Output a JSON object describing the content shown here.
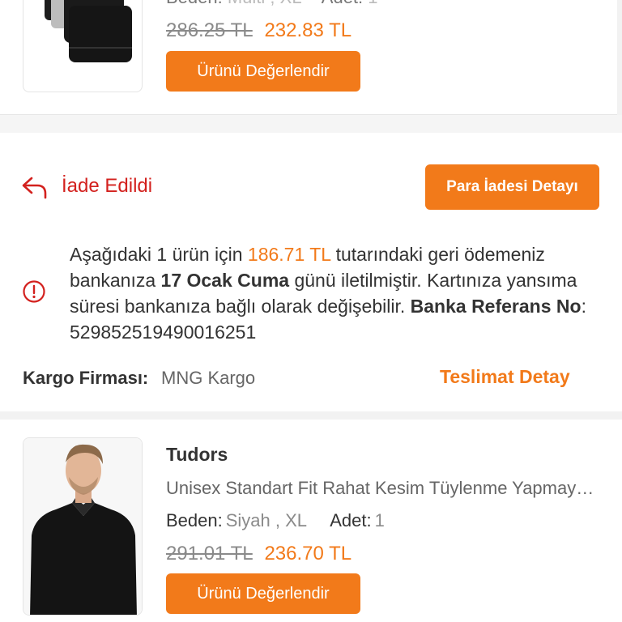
{
  "top_product": {
    "cut_line": {
      "size_label": "Beden:",
      "size_value": "Multi , XL",
      "qty_label": "Adet:",
      "qty_value": "1"
    },
    "old_price": "286.25 TL",
    "new_price": "232.83 TL",
    "review_label": "Ürünü Değerlendir",
    "image_icon": "boxer-pack-image"
  },
  "return_status": {
    "icon": "return-arrow-icon",
    "label": "İade Edildi",
    "refund_button": "Para İadesi Detayı"
  },
  "refund_info": {
    "icon": "info-circle-icon",
    "part1": "Aşağıdaki 1 ürün için ",
    "amount": "186.71 TL",
    "part2": " tutarındaki geri ödemeniz bankanıza ",
    "date": "17 Ocak Cuma",
    "part3": " günü iletilmiştir. Kartınıza yansıma süresi bankanıza bağlı olarak değişebilir. ",
    "ref_label": "Banka Referans No",
    "ref_sep": ": ",
    "ref_value": "529852519490016251"
  },
  "cargo": {
    "label": "Kargo Firması:",
    "value": "MNG Kargo",
    "delivery_link": "Teslimat Detay"
  },
  "bottom_product": {
    "brand": "Tudors",
    "name": "Unisex Standart Fit Rahat Kesim Tüylenme Yapmayan Polar Sweatshirt",
    "size_label": "Beden:",
    "size_value": "Siyah , XL",
    "qty_label": "Adet:",
    "qty_value": "1",
    "old_price": "291.01 TL",
    "new_price": "236.70 TL",
    "review_label": "Ürünü Değerlendir",
    "image_icon": "sweatshirt-model-image"
  },
  "colors": {
    "accent": "#f27a1a",
    "status_red": "#d3211e"
  }
}
